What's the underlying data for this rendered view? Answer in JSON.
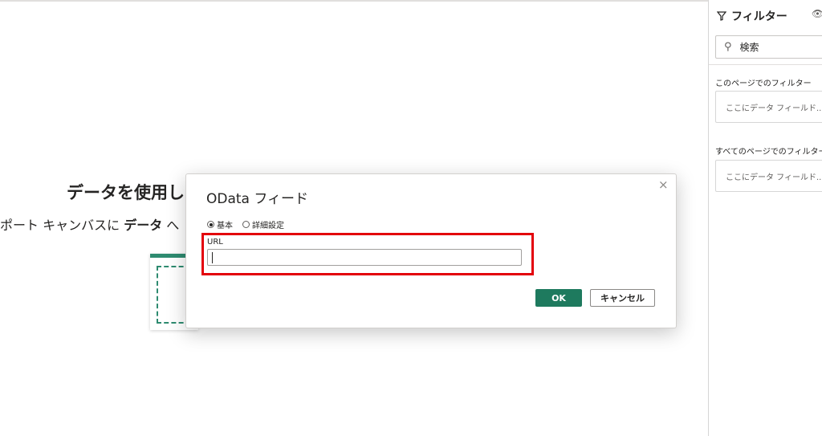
{
  "canvas": {
    "heading": "データを使用し",
    "sub_prefix": "ポート キャンバスに ",
    "sub_bold": "データ",
    "sub_suffix": " へ"
  },
  "filters_pane": {
    "title": "フィルター",
    "search_placeholder": "検索",
    "page_filters_label": "このページでのフィルター",
    "page_filters_drop": "ここにデータ フィールド...",
    "all_pages_filters_label": "すべてのページでのフィルター",
    "all_pages_filters_drop": "ここにデータ フィールド..."
  },
  "dialog": {
    "title": "OData フィード",
    "mode_basic": "基本",
    "mode_advanced": "詳細設定",
    "selected_mode": "基本",
    "url_label": "URL",
    "url_value": "",
    "ok_label": "OK",
    "cancel_label": "キャンセル",
    "close_glyph": "×"
  },
  "colors": {
    "accent": "#1e7a5e",
    "highlight": "#e3000b"
  }
}
